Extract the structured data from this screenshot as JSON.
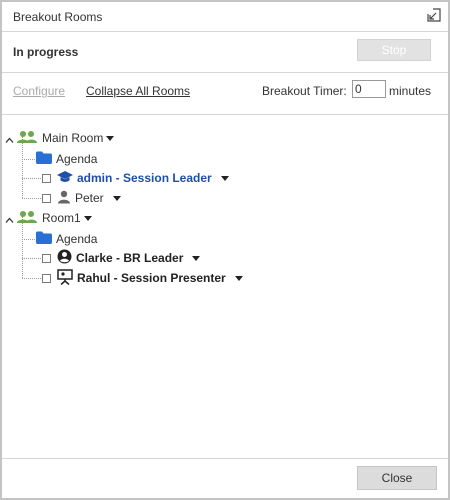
{
  "window": {
    "title": "Breakout Rooms",
    "restore_icon": "restore-window-icon"
  },
  "status": {
    "text": "In progress",
    "stop_label": "Stop"
  },
  "toolbar": {
    "configure_label": "Configure",
    "collapse_label": "Collapse All Rooms",
    "timer_label": "Breakout Timer:",
    "timer_value": "0",
    "minutes_label": "minutes"
  },
  "tree": {
    "rooms": [
      {
        "name": "Main Room",
        "agenda_label": "Agenda",
        "members": [
          {
            "name": "admin - Session Leader",
            "role_icon": "graduation-cap-icon"
          },
          {
            "name": "Peter",
            "role_icon": "person-icon"
          }
        ]
      },
      {
        "name": "Room1",
        "agenda_label": "Agenda",
        "members": [
          {
            "name": "Clarke - BR Leader",
            "role_icon": "user-circle-icon"
          },
          {
            "name": "Rahul - Session Presenter",
            "role_icon": "presenter-icon"
          }
        ]
      }
    ]
  },
  "footer": {
    "close_label": "Close"
  },
  "colors": {
    "leader_text": "#1f4fa8",
    "folder": "#2a6fd6",
    "group_icon": "#6aa84f",
    "disabled_text": "#aaaaaa"
  }
}
